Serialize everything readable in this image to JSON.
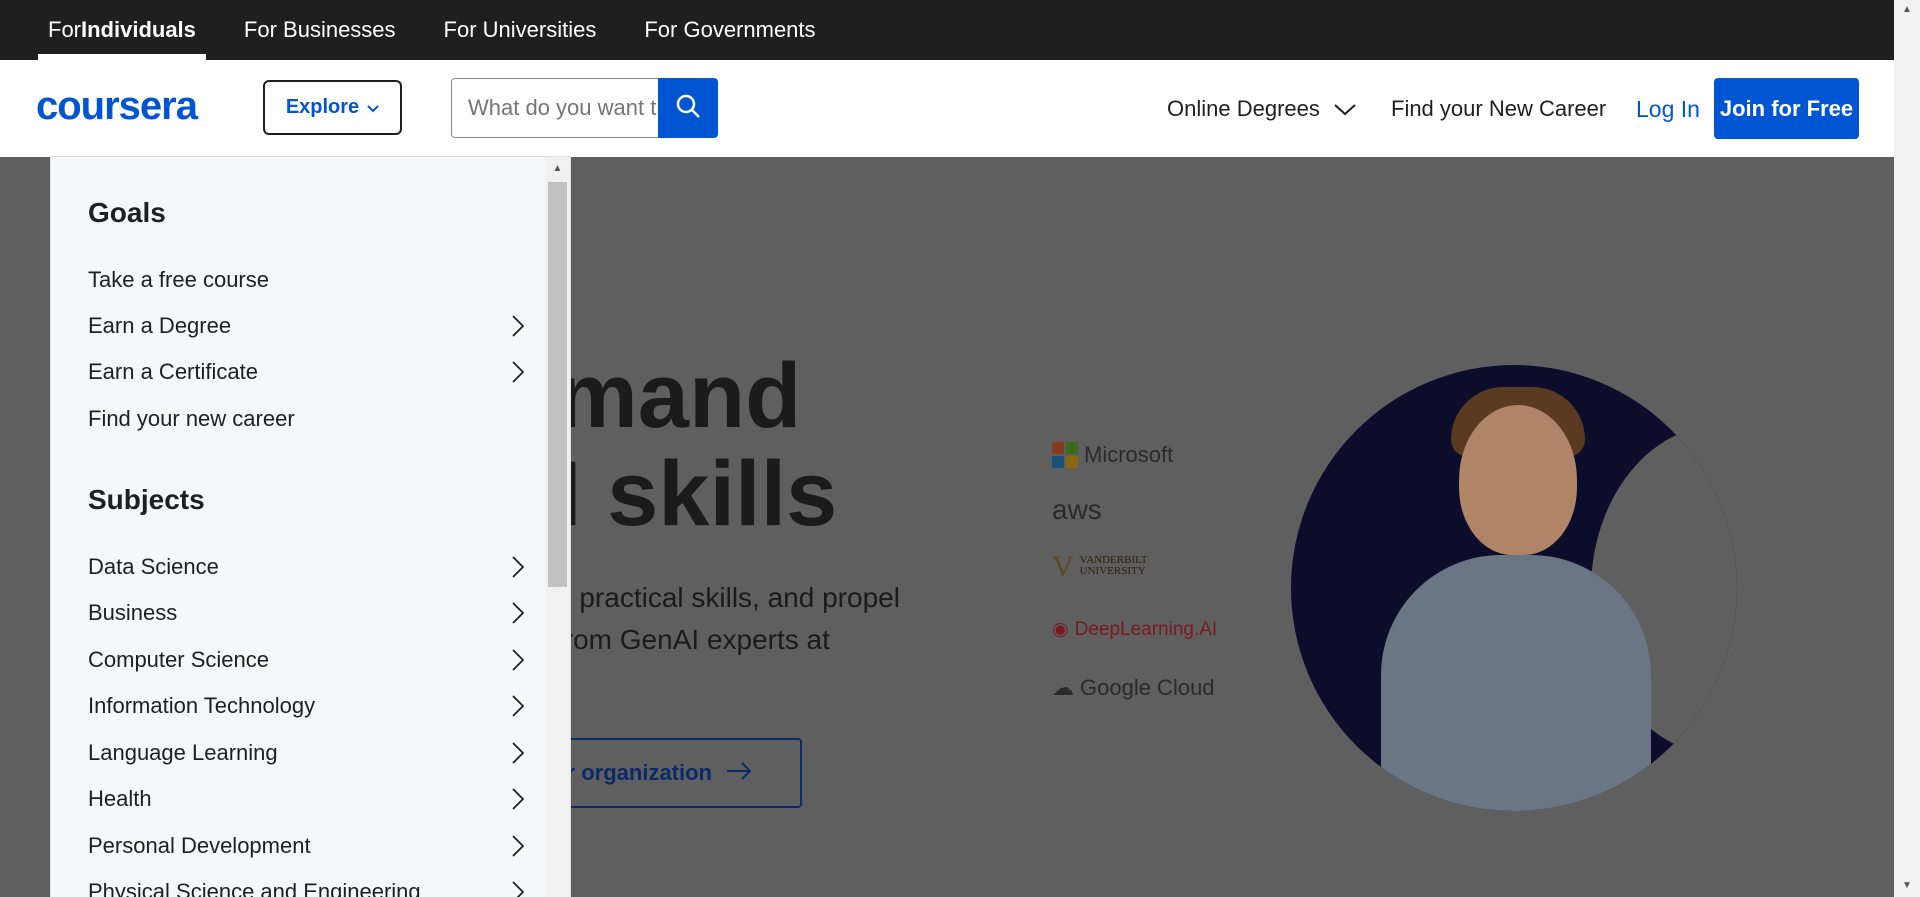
{
  "topbar": {
    "tabs": [
      {
        "prefix": "For ",
        "bold": "Individuals"
      },
      {
        "label": "For Businesses"
      },
      {
        "label": "For Universities"
      },
      {
        "label": "For Governments"
      }
    ]
  },
  "header": {
    "logo": "coursera",
    "explore_label": "Explore",
    "search_placeholder": "What do you want to learn?",
    "online_degrees": "Online Degrees",
    "new_career": "Find your New Career",
    "login": "Log In",
    "join": "Join for Free"
  },
  "hero": {
    "title": "mand\nI skills",
    "subtitle": "d practical skills, and propel\nfrom GenAI experts at",
    "cta": "r organization",
    "partners": [
      "Microsoft",
      "aws",
      "VANDERBILT\nUNIVERSITY",
      "DeepLearning.AI",
      "Google Cloud"
    ]
  },
  "menu": {
    "goals_title": "Goals",
    "goals": [
      {
        "label": "Take a free course",
        "has_submenu": false
      },
      {
        "label": "Earn a Degree",
        "has_submenu": true
      },
      {
        "label": "Earn a Certificate",
        "has_submenu": true
      },
      {
        "label": "Find your new career",
        "has_submenu": false
      }
    ],
    "subjects_title": "Subjects",
    "subjects": [
      {
        "label": "Data Science",
        "has_submenu": true
      },
      {
        "label": "Business",
        "has_submenu": true
      },
      {
        "label": "Computer Science",
        "has_submenu": true
      },
      {
        "label": "Information Technology",
        "has_submenu": true
      },
      {
        "label": "Language Learning",
        "has_submenu": true
      },
      {
        "label": "Health",
        "has_submenu": true
      },
      {
        "label": "Personal Development",
        "has_submenu": true
      },
      {
        "label": "Physical Science and Engineering",
        "has_submenu": true
      }
    ]
  },
  "colors": {
    "brand_blue": "#0056d2",
    "topbar_bg": "#1f1f1f",
    "menu_bg": "#f5f7f8",
    "overlay": "#5f5f5f"
  }
}
